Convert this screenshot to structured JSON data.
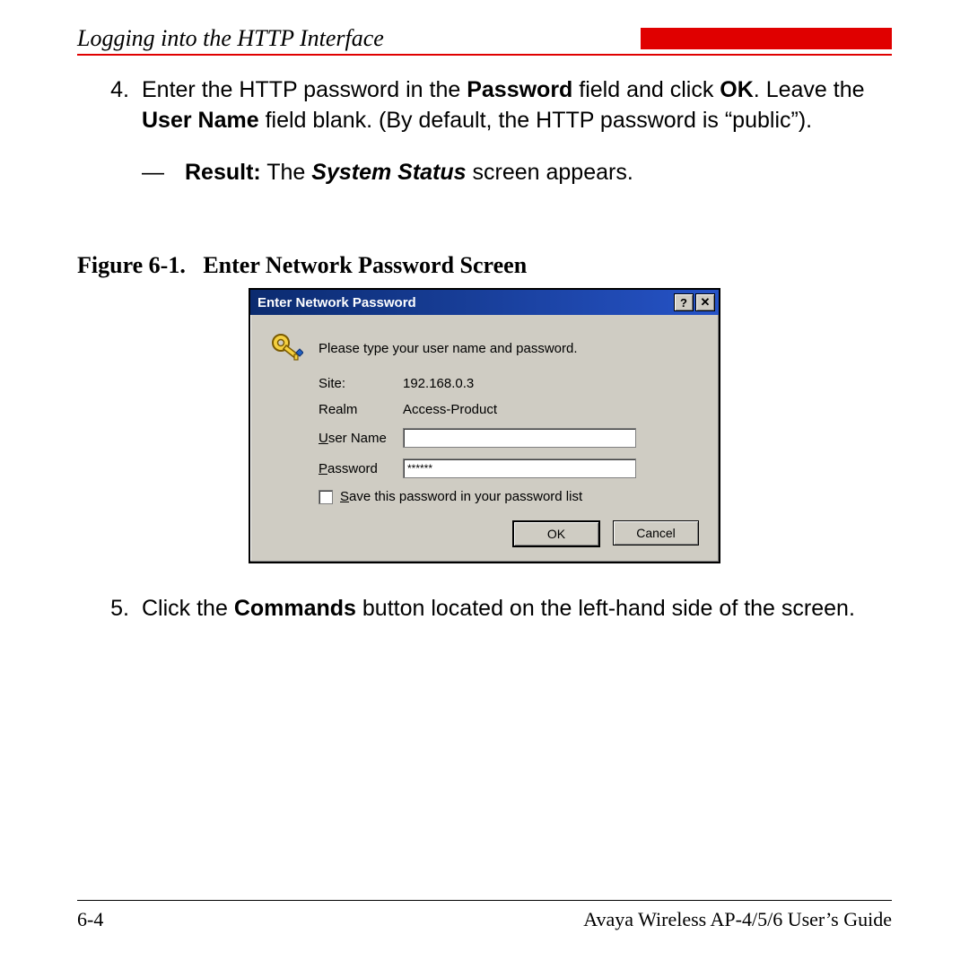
{
  "header": {
    "title": "Logging into the HTTP Interface"
  },
  "steps": {
    "s4": {
      "num": "4.",
      "t1": "Enter the HTTP password in the ",
      "b1": "Password",
      "t2": " field and click ",
      "b2": "OK",
      "t3": ". Leave the ",
      "b3": "User Name",
      "t4": " field blank. (By default, the HTTP password is “public”)."
    },
    "result": {
      "dash": "—",
      "b1": "Result:",
      "t1": " The ",
      "bi1": "System Status",
      "t2": " screen appears."
    },
    "s5": {
      "num": "5.",
      "t1": "Click the ",
      "b1": "Commands",
      "t2": " button located on the left-hand side of the screen."
    }
  },
  "figure": {
    "caption_label": "Figure 6-1.",
    "caption_title": "Enter Network Password Screen"
  },
  "dialog": {
    "title": "Enter Network Password",
    "help_glyph": "?",
    "close_glyph": "✕",
    "prompt": "Please type your user name and password.",
    "site_label": "Site:",
    "site_value": "192.168.0.3",
    "realm_label": "Realm",
    "realm_value": "Access-Product",
    "username_label_u": "U",
    "username_label_rest": "ser Name",
    "username_value": "",
    "password_label_u": "P",
    "password_label_rest": "assword",
    "password_value": "******",
    "save_label_u": "S",
    "save_label_rest": "ave this password in your password list",
    "ok_label": "OK",
    "cancel_label": "Cancel"
  },
  "footer": {
    "page": "6-4",
    "book": "Avaya Wireless AP-4/5/6 User’s Guide"
  }
}
